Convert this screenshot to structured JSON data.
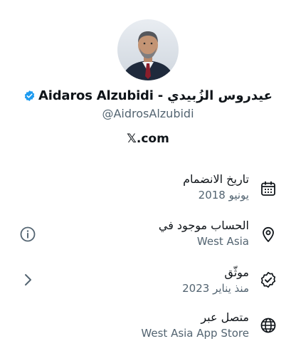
{
  "profile": {
    "display_name": "Aidaros Alzubidi - عيدروس الزُبيدي",
    "handle": "@AidrosAlzubidi",
    "website_prefix": "𝕏",
    "website_suffix": ".com",
    "verified_color": "#1d9bf0"
  },
  "about": {
    "joined": {
      "label": "تاريخ الانضمام",
      "value": "يونيو 2018",
      "icon": "calendar-icon"
    },
    "based_in": {
      "label": "الحساب موجود في",
      "value": "West Asia",
      "icon": "location-pin-icon",
      "side_icon": "info-icon"
    },
    "verified": {
      "label": "موثّق",
      "value": "منذ يناير 2023",
      "icon": "verified-badge-icon",
      "side_icon": "chevron-left-icon"
    },
    "connected_via": {
      "label": "متصل عبر",
      "value": "West Asia App Store",
      "icon": "globe-icon"
    }
  }
}
